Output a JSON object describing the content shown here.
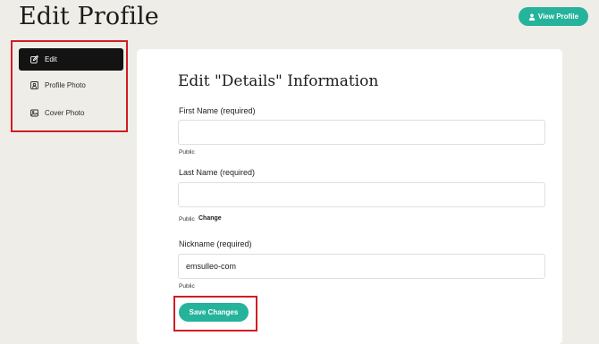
{
  "header": {
    "title": "Edit Profile",
    "view_profile_label": "View Profile",
    "view_profile_icon": "user-icon"
  },
  "sidebar": {
    "items": [
      {
        "label": "Edit",
        "icon": "edit-icon",
        "active": true
      },
      {
        "label": "Profile Photo",
        "icon": "profile-photo-icon",
        "active": false
      },
      {
        "label": "Cover Photo",
        "icon": "cover-photo-icon",
        "active": false
      }
    ]
  },
  "form": {
    "title": "Edit \"Details\" Information",
    "fields": [
      {
        "label": "First Name (required)",
        "value": "",
        "visibility": "Public"
      },
      {
        "label": "Last Name (required)",
        "value": "",
        "visibility": "Public",
        "change_label": "Change"
      },
      {
        "label": "Nickname (required)",
        "value": "emsulleo-com",
        "visibility": "Public"
      }
    ],
    "save_label": "Save Changes"
  },
  "colors": {
    "accent": "#26b39b",
    "highlight_border": "#d01d24",
    "sidebar_active_bg": "#131313",
    "page_bg": "#efede8"
  }
}
